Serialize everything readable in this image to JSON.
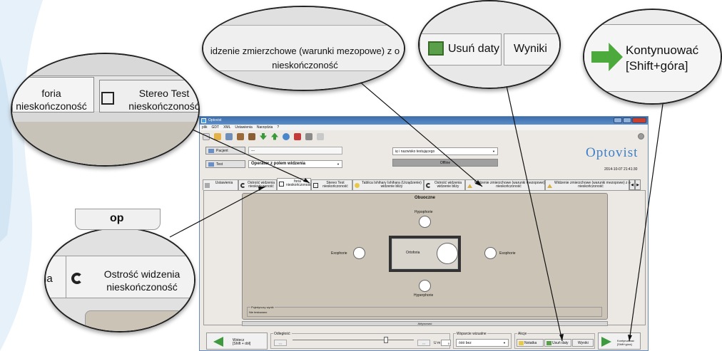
{
  "window": {
    "title": "Optovist",
    "menu": [
      "plik",
      "GDT",
      "XML",
      "Ustawienia",
      "Narzędzia",
      "?"
    ]
  },
  "header": {
    "patient_label": "Pacjent",
    "patient_value": "---",
    "test_label": "Test",
    "test_value": "Operator z polem widzenia",
    "tester_placeholder": "ię i nazwisko testującego",
    "status": "Offline",
    "brand": "Optovist",
    "datetime": "2014-10-07  21:41:30"
  },
  "tabs": [
    {
      "label": "Ustawienia",
      "active": false
    },
    {
      "label": "Ostrość widzenia\nnieskończoność",
      "active": false
    },
    {
      "label": "foria\nnieskończoność",
      "active": true
    },
    {
      "label": "Stereo Test\nnieskończoność",
      "active": false
    },
    {
      "label": "Tablica Ishihary Ishihara (Urządzenie)\nwidzenie bliży",
      "active": false
    },
    {
      "label": "Ostrość widzenia\nwidzenie bliży",
      "active": false
    },
    {
      "label": "Widzenie zmierzchowe (warunki mezopowe)\nnieskończoność",
      "active": false
    },
    {
      "label": "Widzenie zmierzchowe (warunki mezopowe) z o\nnieskończoność",
      "active": false
    }
  ],
  "panel": {
    "title": "Obuoczne",
    "top": "Hypophorie",
    "left": "Exophorie",
    "center": "Ortoforia",
    "right": "Esophorie",
    "bottom": "Hyperphorie",
    "single_title": "Pojedynczy wynik",
    "single_value": "Nie testowano",
    "activate": "Aktywować"
  },
  "bottom": {
    "back": "Wstecz\n[Shift + dół]",
    "distance_label": "Odległość:",
    "slider_left": "<<",
    "slider_right": ">>",
    "distance_value": "0",
    "distance_unit": "U m",
    "visual_aid_label": "Wsparcie wizualne",
    "visual_aid_value": "óóó bez",
    "actions_label": "Akcje",
    "note": "Notatka",
    "delete_dates": "Usuń daty",
    "results": "Wyniki",
    "continue": "Kontynuować\n[Shift+góra]"
  },
  "zooms": {
    "tabs": {
      "left": "foria\nnieskończoność",
      "right": "Stereo Test\nnieskończoność"
    },
    "mesopic": "idzenie zmierzchowe (warunki mezopowe) z o\nnieskończoność",
    "actions": {
      "delete": "Usuń daty",
      "results": "Wyniki"
    },
    "continue": "Kontynuować\n[Shift+góra]",
    "visual_acuity": {
      "partial": "ia",
      "label": "Ostrość widzenia\nnieskończoność"
    },
    "top_partial": "op"
  }
}
